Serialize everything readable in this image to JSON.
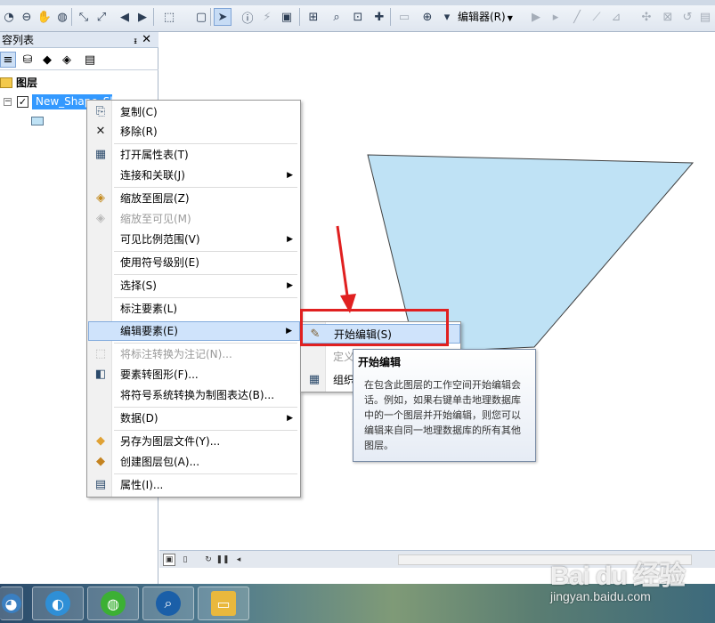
{
  "toolbar": {
    "editor_label": "编辑器(R)",
    "icons": [
      "zoom-out-icon",
      "pan-icon",
      "globe-icon",
      "full-extent-icon",
      "fixed-zoom-icon",
      "back-icon",
      "forward-icon",
      "select-features-icon",
      "clear-selection-icon",
      "select-pointer-icon",
      "identify-icon",
      "hyperlink-icon",
      "html-popup-icon",
      "measure-icon",
      "find-icon",
      "go-to-xy-icon",
      "time-slider-icon",
      "create-viewer-icon",
      "editor-toolbar-icon",
      "edit-tool-icon",
      "sketch-icon",
      "line-icon",
      "vertex-icon",
      "trace-icon"
    ]
  },
  "toc": {
    "title": "容列表",
    "layers_label": "图层",
    "layer_name": "New_Shape_Sh",
    "layer_checked": "✓",
    "expand_symbol": "−"
  },
  "context_menu": {
    "items": [
      {
        "label": "复制(C)",
        "icon": "copy-icon",
        "glyph": "⎘"
      },
      {
        "label": "移除(R)",
        "icon": "remove-icon",
        "glyph": "✕"
      },
      {
        "label": "打开属性表(T)",
        "icon": "table-icon",
        "glyph": "▦"
      },
      {
        "label": "连接和关联(J)",
        "icon": "",
        "glyph": "",
        "submenu": true
      },
      {
        "label": "缩放至图层(Z)",
        "icon": "zoom-to-layer-icon",
        "glyph": "◈"
      },
      {
        "label": "缩放至可见(M)",
        "icon": "zoom-visible-icon",
        "glyph": "◈",
        "disabled": true
      },
      {
        "label": "可见比例范围(V)",
        "icon": "",
        "glyph": "",
        "submenu": true
      },
      {
        "label": "使用符号级别(E)",
        "icon": "",
        "glyph": ""
      },
      {
        "label": "选择(S)",
        "icon": "",
        "glyph": "",
        "submenu": true
      },
      {
        "label": "标注要素(L)",
        "icon": "",
        "glyph": ""
      },
      {
        "label": "编辑要素(E)",
        "icon": "",
        "glyph": "",
        "submenu": true,
        "hover": true
      },
      {
        "label": "将标注转换为注记(N)...",
        "icon": "convert-labels-icon",
        "glyph": "⬚",
        "disabled": true
      },
      {
        "label": "要素转图形(F)...",
        "icon": "features-to-graphics-icon",
        "glyph": "◧"
      },
      {
        "label": "将符号系统转换为制图表达(B)...",
        "icon": "",
        "glyph": ""
      },
      {
        "label": "数据(D)",
        "icon": "",
        "glyph": "",
        "submenu": true
      },
      {
        "label": "另存为图层文件(Y)...",
        "icon": "layer-file-icon",
        "glyph": "◆"
      },
      {
        "label": "创建图层包(A)...",
        "icon": "layer-package-icon",
        "glyph": "◆"
      },
      {
        "label": "属性(I)...",
        "icon": "properties-icon",
        "glyph": "▤"
      }
    ]
  },
  "submenu": {
    "items": [
      {
        "label": "开始编辑(S)",
        "icon": "start-editing-icon",
        "glyph": "✎",
        "hover": true
      },
      {
        "label": "定义",
        "icon": "",
        "glyph": "",
        "partial": true
      },
      {
        "label": "组织",
        "icon": "organize-icon",
        "glyph": "▦"
      }
    ]
  },
  "tooltip": {
    "title": "开始编辑",
    "body": "在包含此图层的工作空间开始编辑会话。例如，如果右键单击地理数据库中的一个图层并开始编辑，则您可以编辑来自同一地理数据库的所有其他图层。"
  },
  "watermark": {
    "logo": "Bai du 经验",
    "url": "jingyan.baidu.com"
  },
  "colors": {
    "polygon_fill": "#bfe2f5",
    "highlight_box": "#e02020",
    "arrow": "#e02020",
    "selection": "#3399ff"
  }
}
